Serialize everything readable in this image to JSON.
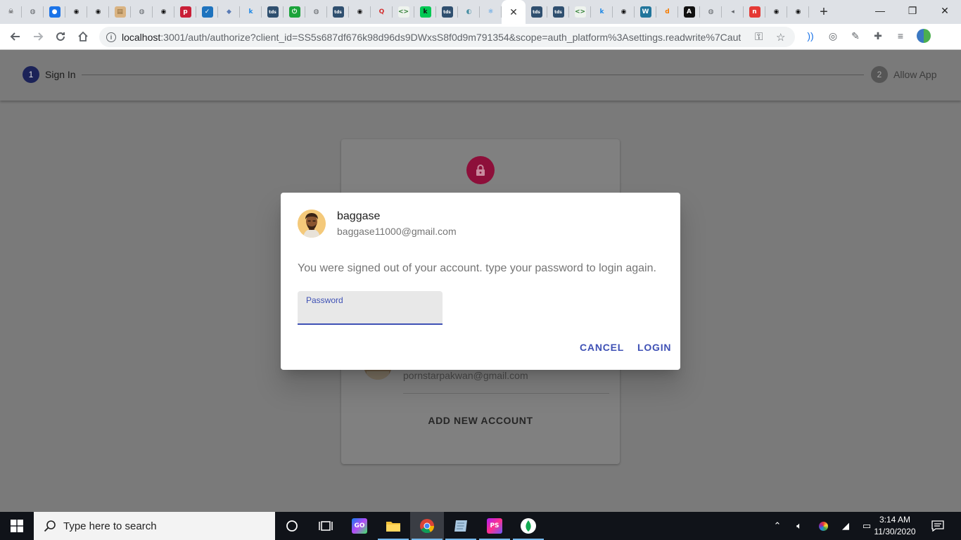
{
  "browser": {
    "tab_favicons": [
      {
        "name": "skull-favicon",
        "glyph": "☠",
        "bg": "#dee1e6",
        "fg": "#222"
      },
      {
        "name": "globe-favicon",
        "glyph": "◍",
        "bg": "#dee1e6",
        "fg": "#5f6368"
      },
      {
        "name": "blue-circle-favicon",
        "glyph": "●",
        "bg": "#1a73e8",
        "fg": "#fff"
      },
      {
        "name": "github-favicon",
        "glyph": "◉",
        "bg": "#dee1e6",
        "fg": "#111"
      },
      {
        "name": "github-favicon",
        "glyph": "◉",
        "bg": "#dee1e6",
        "fg": "#111"
      },
      {
        "name": "box-favicon",
        "glyph": "▤",
        "bg": "#d9b382",
        "fg": "#8a6a3a"
      },
      {
        "name": "globe-favicon",
        "glyph": "◍",
        "bg": "#dee1e6",
        "fg": "#5f6368"
      },
      {
        "name": "github-favicon",
        "glyph": "◉",
        "bg": "#dee1e6",
        "fg": "#111"
      },
      {
        "name": "p-favicon",
        "glyph": "p",
        "bg": "#c91f37",
        "fg": "#fff"
      },
      {
        "name": "checkbox-favicon",
        "glyph": "✓",
        "bg": "#1e73be",
        "fg": "#fff"
      },
      {
        "name": "shield-favicon",
        "glyph": "◆",
        "bg": "#dee1e6",
        "fg": "#5a7bb5"
      },
      {
        "name": "k-favicon",
        "glyph": "k",
        "bg": "#dee1e6",
        "fg": "#1e88e5"
      },
      {
        "name": "tds-favicon",
        "glyph": "tds",
        "bg": "#2f4f6f",
        "fg": "#fff"
      },
      {
        "name": "power-favicon",
        "glyph": "⏻",
        "bg": "#1aa33a",
        "fg": "#fff"
      },
      {
        "name": "globe-favicon",
        "glyph": "◍",
        "bg": "#dee1e6",
        "fg": "#5f6368"
      },
      {
        "name": "tds-favicon",
        "glyph": "tds",
        "bg": "#2f4f6f",
        "fg": "#fff"
      },
      {
        "name": "github-favicon",
        "glyph": "◉",
        "bg": "#dee1e6",
        "fg": "#111"
      },
      {
        "name": "q-favicon",
        "glyph": "Q",
        "bg": "#dee1e6",
        "fg": "#d32f2f"
      },
      {
        "name": "code-favicon",
        "glyph": "<>",
        "bg": "#eef3ee",
        "fg": "#2e7d32"
      },
      {
        "name": "green-favicon",
        "glyph": "k",
        "bg": "#00c853",
        "fg": "#111"
      },
      {
        "name": "tds-favicon",
        "glyph": "tds",
        "bg": "#2f4f6f",
        "fg": "#fff"
      },
      {
        "name": "bucket-favicon",
        "glyph": "◐",
        "bg": "#dee1e6",
        "fg": "#4a90a4"
      },
      {
        "name": "react-favicon",
        "glyph": "⚛",
        "bg": "#dee1e6",
        "fg": "#1e88e5"
      }
    ],
    "tab_favicons_after": [
      {
        "name": "tds-favicon",
        "glyph": "tds",
        "bg": "#2f4f6f",
        "fg": "#fff"
      },
      {
        "name": "tds-favicon",
        "glyph": "tds",
        "bg": "#2f4f6f",
        "fg": "#fff"
      },
      {
        "name": "code-favicon",
        "glyph": "<>",
        "bg": "#eef3ee",
        "fg": "#2e7d32"
      },
      {
        "name": "k-favicon",
        "glyph": "k",
        "bg": "#dee1e6",
        "fg": "#1e88e5"
      },
      {
        "name": "github-favicon",
        "glyph": "◉",
        "bg": "#dee1e6",
        "fg": "#111"
      },
      {
        "name": "wordpress-favicon",
        "glyph": "W",
        "bg": "#21759b",
        "fg": "#fff"
      },
      {
        "name": "d-favicon",
        "glyph": "d",
        "bg": "#dee1e6",
        "fg": "#f57c00"
      },
      {
        "name": "a-favicon",
        "glyph": "A",
        "bg": "#111",
        "fg": "#fff"
      },
      {
        "name": "globe-favicon",
        "glyph": "◍",
        "bg": "#dee1e6",
        "fg": "#5f6368"
      },
      {
        "name": "speaker-favicon",
        "glyph": "◂",
        "bg": "#dee1e6",
        "fg": "#5f6368"
      },
      {
        "name": "n-favicon",
        "glyph": "n",
        "bg": "#e53935",
        "fg": "#fff"
      },
      {
        "name": "github-favicon",
        "glyph": "◉",
        "bg": "#dee1e6",
        "fg": "#111"
      },
      {
        "name": "github-favicon",
        "glyph": "◉",
        "bg": "#dee1e6",
        "fg": "#111"
      }
    ],
    "active_tab_close": "✕",
    "new_tab": "+",
    "window_controls": {
      "minimize": "—",
      "restore": "❐",
      "close": "✕"
    },
    "url_host": "localhost",
    "url_rest": ":3001/auth/authorize?client_id=SS5s687df676k98d96ds9DWxsS8f0d9m791354&scope=auth_platform%3Asettings.readwrite%7Caut..."
  },
  "stepper": {
    "steps": [
      {
        "number": "1",
        "label": "Sign In"
      },
      {
        "number": "2",
        "label": "Allow App"
      }
    ]
  },
  "card": {
    "other_account_email": "pornstarpakwan@gmail.com",
    "add_account_label": "ADD NEW ACCOUNT"
  },
  "dialog": {
    "name": "baggase",
    "email": "baggase11000@gmail.com",
    "message": "You were signed out of your account. type your password to login again.",
    "password_label": "Password",
    "password_value": "",
    "cancel_label": "CANCEL",
    "login_label": "LOGIN",
    "accent_color": "#3f51b5"
  },
  "taskbar": {
    "search_placeholder": "Type here to search",
    "time": "3:14 AM",
    "date": "11/30/2020"
  }
}
